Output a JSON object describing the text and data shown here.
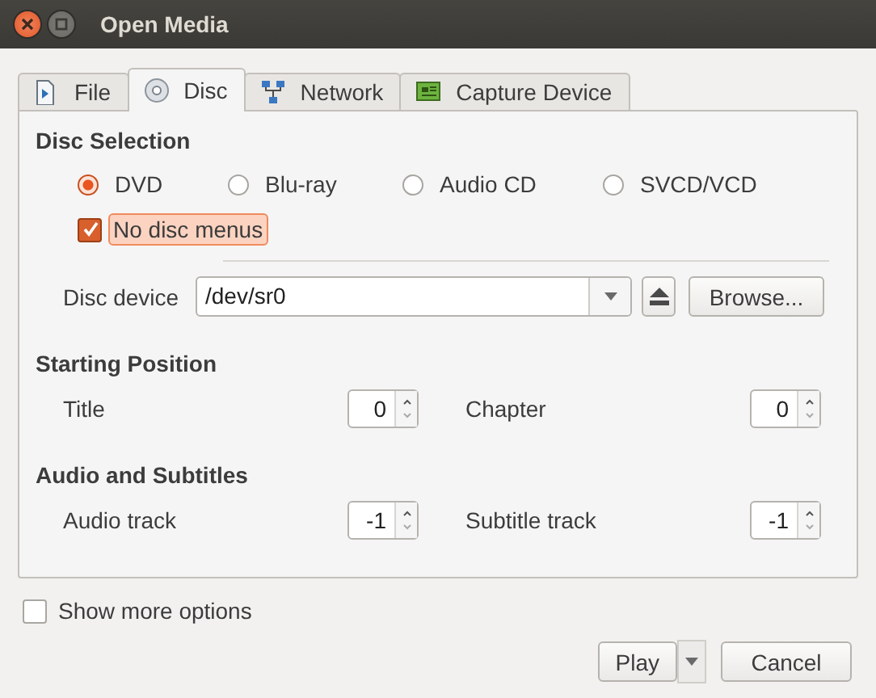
{
  "window": {
    "title": "Open Media"
  },
  "tabs": [
    {
      "label": "File",
      "kind": "file",
      "selected": false
    },
    {
      "label": "Disc",
      "kind": "disc",
      "selected": true
    },
    {
      "label": "Network",
      "kind": "network",
      "selected": false
    },
    {
      "label": "Capture Device",
      "kind": "capture",
      "selected": false
    }
  ],
  "disc_selection": {
    "heading": "Disc Selection",
    "types": [
      {
        "label": "DVD",
        "selected": true
      },
      {
        "label": "Blu-ray",
        "selected": false
      },
      {
        "label": "Audio CD",
        "selected": false
      },
      {
        "label": "SVCD/VCD",
        "selected": false
      }
    ],
    "no_disc_menus": {
      "label": "No disc menus",
      "checked": true,
      "focused": true
    },
    "device": {
      "label": "Disc device",
      "value": "/dev/sr0",
      "browse": "Browse..."
    }
  },
  "starting_position": {
    "heading": "Starting Position",
    "fields": [
      {
        "label": "Title",
        "value": "0"
      },
      {
        "label": "Chapter",
        "value": "0"
      }
    ]
  },
  "audio_and_subtitles": {
    "heading": "Audio and Subtitles",
    "fields": [
      {
        "label": "Audio track",
        "value": "-1"
      },
      {
        "label": "Subtitle track",
        "value": "-1"
      }
    ]
  },
  "show_more_options": {
    "label": "Show more options",
    "checked": false
  },
  "buttons": [
    {
      "label": "Play",
      "kind": "split"
    },
    {
      "label": "Cancel",
      "kind": "plain"
    }
  ]
}
